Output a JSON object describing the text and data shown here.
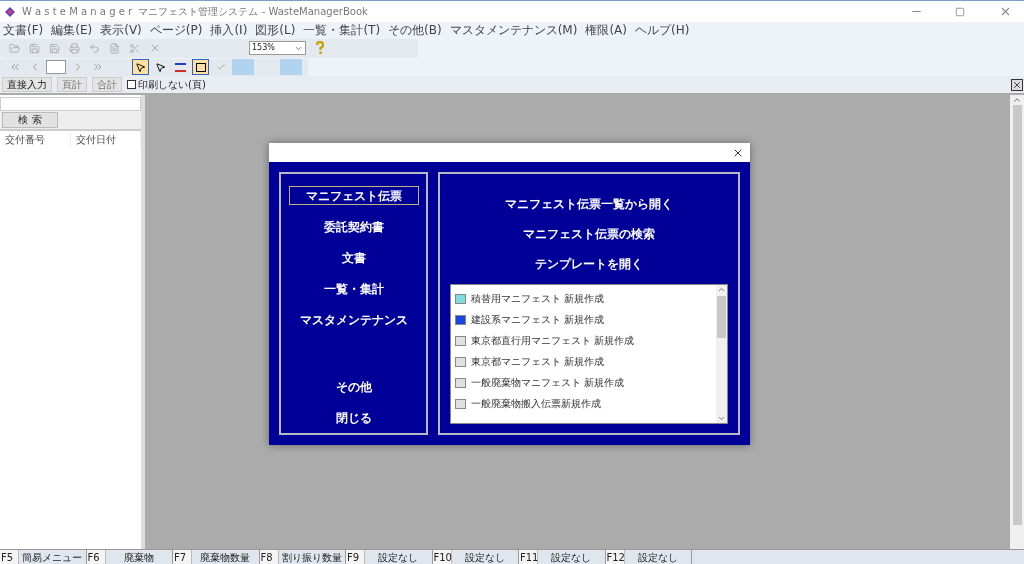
{
  "window": {
    "title": "W a s t e M a n a g e r  マニフェスト管理システム - WasteManagerBook"
  },
  "menu": [
    "文書(F)",
    "編集(E)",
    "表示(V)",
    "ページ(P)",
    "挿入(I)",
    "図形(L)",
    "一覧・集計(T)",
    "その他(B)",
    "マスタメンテナンス(M)",
    "権限(A)",
    "ヘルプ(H)"
  ],
  "toolbar": {
    "zoom": "153%"
  },
  "subbar": {
    "buttons": [
      {
        "label": "直接入力",
        "disabled": false
      },
      {
        "label": "頁計",
        "disabled": true
      },
      {
        "label": "合計",
        "disabled": true
      }
    ],
    "checkbox": {
      "label": "印刷しない(頁)",
      "checked": false
    }
  },
  "left_panel": {
    "search_button": "検 索",
    "columns": [
      "交付番号",
      "交付日付"
    ]
  },
  "dialog": {
    "nav": [
      {
        "label": "マニフェスト伝票",
        "selected": true
      },
      {
        "label": "委託契約書",
        "selected": false
      },
      {
        "label": "文書",
        "selected": false
      },
      {
        "label": "一覧・集計",
        "selected": false
      },
      {
        "label": "マスタメンテナンス",
        "selected": false
      },
      {
        "label": "その他",
        "selected": false
      },
      {
        "label": "閉じる",
        "selected": false
      }
    ],
    "actions": [
      "マニフェスト伝票一覧から開く",
      "マニフェスト伝票の検索",
      "テンプレートを開く"
    ],
    "templates": [
      {
        "label": "積替用マニフェスト 新規作成",
        "color": "#7fdcdc"
      },
      {
        "label": "建設系マニフェスト 新規作成",
        "color": "#1446e0"
      },
      {
        "label": "東京都直行用マニフェスト 新規作成",
        "color": "#e0e0e0"
      },
      {
        "label": "東京都マニフェスト 新規作成",
        "color": "#e0e0e0"
      },
      {
        "label": "一般廃棄物マニフェスト 新規作成",
        "color": "#e0e0e0"
      },
      {
        "label": "一般廃棄物搬入伝票新規作成",
        "color": "#e0e0e0"
      }
    ]
  },
  "function_keys": [
    {
      "key": "F5",
      "label": "簡易メニュー"
    },
    {
      "key": "F6",
      "label": "廃棄物"
    },
    {
      "key": "F7",
      "label": "廃棄物数量"
    },
    {
      "key": "F8",
      "label": "割り振り数量"
    },
    {
      "key": "F9",
      "label": "設定なし"
    },
    {
      "key": "F10",
      "label": "設定なし"
    },
    {
      "key": "F11",
      "label": "設定なし"
    },
    {
      "key": "F12",
      "label": "設定なし"
    }
  ]
}
